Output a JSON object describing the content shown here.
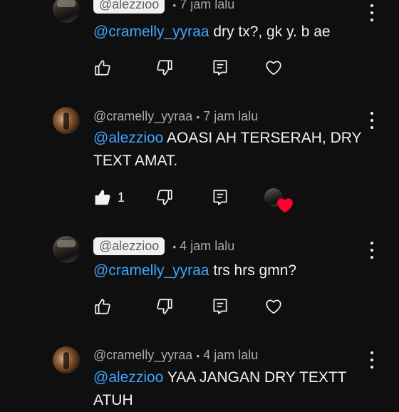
{
  "comments": [
    {
      "chip": "@alezzioo",
      "time": "7 jam lalu",
      "mention": "@cramelly_yyraa",
      "text": " dry tx?, gk y. b ae"
    },
    {
      "author": "@cramelly_yyraa",
      "time": "7 jam lalu",
      "mention": "@alezzioo",
      "text": " AOASI AH TERSERAH, DRY TEXT AMAT.",
      "likes": "1"
    },
    {
      "chip": "@alezzioo",
      "time": "4 jam lalu",
      "mention": "@cramelly_yyraa",
      "text": " trs hrs gmn?"
    },
    {
      "author": "@cramelly_yyraa",
      "time": "4 jam lalu",
      "mention": "@alezzioo",
      "text": "  YAA JANGAN DRY TEXTT ATUH"
    }
  ],
  "separator": "•",
  "icons": [
    "like-icon",
    "dislike-icon",
    "reply-icon",
    "heart-icon",
    "more-icon"
  ],
  "colors": {
    "background": "#0f0f0f",
    "mention": "#3ea6ff",
    "heart": "#ff0033"
  }
}
